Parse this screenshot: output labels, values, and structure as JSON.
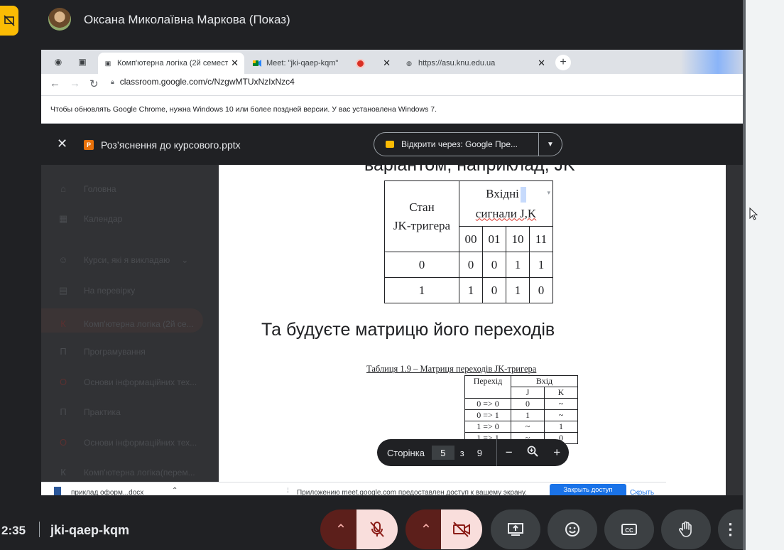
{
  "presenter": {
    "name": "Оксана Миколаївна Маркова (Показ)"
  },
  "browser": {
    "tabs": [
      {
        "label": "Комп'ютерна логіка (2й семестр)",
        "close": "✕"
      },
      {
        "label": "Meet: \"jki-qaep-kqm\"",
        "close": "✕"
      },
      {
        "label": "https://asu.knu.edu.ua",
        "close": "✕"
      }
    ],
    "new_tab": "+",
    "url": "classroom.google.com/c/NzgwMTUxNzIxNzc4",
    "infobar": "Чтобы обновлять Google Chrome, нужна Windows 10 или более поздней версии. У вас установлена Windows 7."
  },
  "viewer": {
    "file_name": "Роз’яснення до курсового.pptx",
    "open_with": "Відкрити через: Google Пре...",
    "close_icon": "✕"
  },
  "classroom_sidebar": [
    {
      "icon": "⌂",
      "label": "Головна"
    },
    {
      "icon": "▦",
      "label": "Календар"
    },
    {
      "icon": "☺",
      "label": "Курси, які я викладаю"
    },
    {
      "icon": "▤",
      "label": "На перевірку"
    },
    {
      "icon": "К",
      "label": "Комп'ютерна логіка (2й се..."
    },
    {
      "icon": "П",
      "label": "Програмування"
    },
    {
      "icon": "О",
      "label": "Основи інформаційних тех..."
    },
    {
      "icon": "П",
      "label": "Практика"
    },
    {
      "icon": "О",
      "label": "Основи інформаційних тех..."
    },
    {
      "icon": "К",
      "label": "Комп'ютерна логіка(перем..."
    }
  ],
  "slide": {
    "cut_text": "варіантом, наприклад, JK",
    "jk_table": {
      "header_state": [
        "Стан",
        "JK-тригера"
      ],
      "header_inputs": [
        "Вхідні",
        "сигнали J,K"
      ],
      "input_cols": [
        "00",
        "01",
        "10",
        "11"
      ],
      "rows": [
        {
          "state": "0",
          "values": [
            "0",
            "0",
            "1",
            "1"
          ]
        },
        {
          "state": "1",
          "values": [
            "1",
            "0",
            "1",
            "0"
          ]
        }
      ]
    },
    "heading": "Та будуєте матрицю його переходів",
    "caption": "Таблиця 1.9 – Матриця переходів JK-тригера",
    "transition_table": {
      "col_transition": "Перехід",
      "col_input": "Вхід",
      "sub_j": "J",
      "sub_k": "K",
      "rows": [
        {
          "t": "0 => 0",
          "j": "0",
          "k": "~"
        },
        {
          "t": "0 => 1",
          "j": "1",
          "k": "~"
        },
        {
          "t": "1 => 0",
          "j": "~",
          "k": "1"
        },
        {
          "t": "1 => 1",
          "j": "~",
          "k": "0"
        }
      ]
    }
  },
  "page_nav": {
    "label": "Сторінка",
    "current": "5",
    "of": "з",
    "total": "9"
  },
  "downloads": {
    "file": "приклад оформ...docx"
  },
  "share_banner": {
    "text": "Приложению meet.google.com предоставлен доступ к вашему экрану.",
    "stop_button": "Закрыть доступ",
    "hide_link": "Скрыть"
  },
  "meet": {
    "time": "2:35",
    "code": "jki-qaep-kqm"
  }
}
